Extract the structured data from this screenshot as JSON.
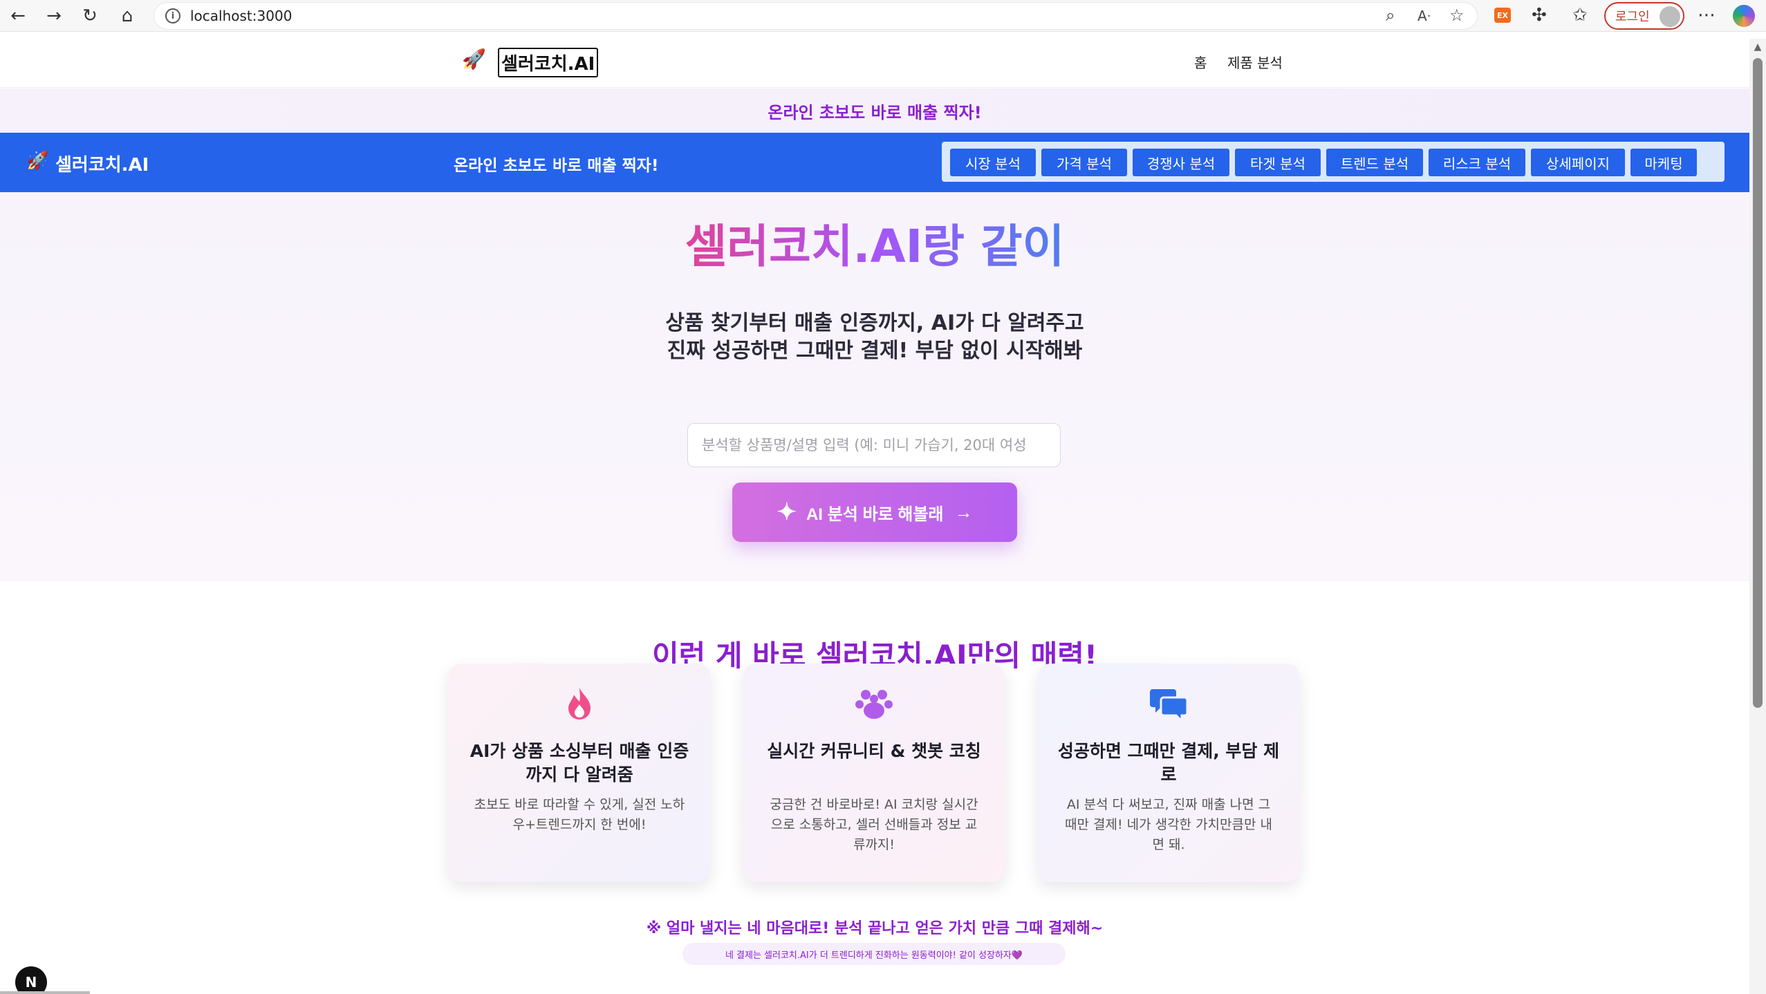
{
  "browser": {
    "url": "localhost:3000",
    "login_label": "로그인",
    "ext_label": "EX"
  },
  "topnav": {
    "rocket": "🚀",
    "brand": "셀러코치.AI",
    "links": [
      "홈",
      "제품 분석"
    ]
  },
  "promo": {
    "text": "온라인 초보도 바로 매출 찍자!"
  },
  "bluebar": {
    "rocket": "🚀",
    "brand": "셀러코치.AI",
    "tagline": "온라인 초보도 바로 매출 찍자!",
    "tabs": [
      "시장 분석",
      "가격 분석",
      "경쟁사 분석",
      "타겟 분석",
      "트렌드 분석",
      "리스크 분석",
      "상세페이지",
      "마케팅"
    ]
  },
  "hero": {
    "title": "셀러코치.AI랑 같이",
    "subtitle_line1": "상품 찾기부터 매출 인증까지, AI가 다 알려주고",
    "subtitle_line2": "진짜 성공하면 그때만 결제! 부담 없이 시작해봐",
    "input_placeholder": "분석할 상품명/설명 입력 (예: 미니 가습기, 20대 여성",
    "button_label": "AI 분석 바로 해볼래"
  },
  "features": {
    "title": "이런 게 바로 셀러코치.AI만의 매력!",
    "cards": [
      {
        "icon": "fire-icon",
        "title": "AI가 상품 소싱부터 매출 인증까지 다 알려줌",
        "desc": "초보도 바로 따라할 수 있게, 실전 노하우+트렌드까지 한 번에!"
      },
      {
        "icon": "paw-icon",
        "title": "실시간 커뮤니티 & 챗봇 코칭",
        "desc": "궁금한 건 바로바로! AI 코치랑 실시간으로 소통하고, 셀러 선배들과 정보 교류까지!"
      },
      {
        "icon": "chat-bubbles-icon",
        "title": "성공하면 그때만 결제, 부담 제로",
        "desc": "AI 분석 다 써보고, 진짜 매출 나면 그때만 결제! 네가 생각한 가치만큼만 내면 돼."
      }
    ]
  },
  "footnote": {
    "main": "※ 얼마 낼지는 네 마음대로! 분석 끝나고 얻은 가치 만큼 그때 결제해~",
    "pill": "네 결제는 셀러코치.AI가 더 트렌디하게 진화하는 원동력이야! 같이 성장하자💜"
  },
  "dev_badge": "N",
  "colors": {
    "brand_blue": "#2563eb",
    "accent_purple": "#8b1fd0",
    "gradient_pink": "#e0439a",
    "gradient_blue": "#4f7ef0"
  }
}
